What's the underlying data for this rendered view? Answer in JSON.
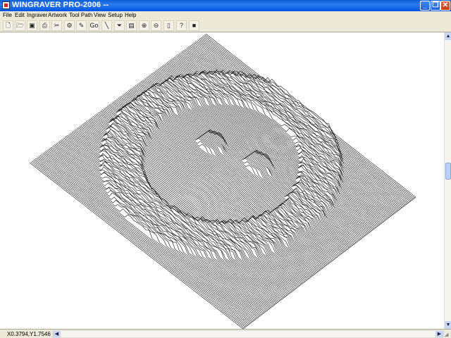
{
  "window": {
    "title": "WINGRAVER PRO-2006 --",
    "minimize_glyph": "_",
    "maximize_glyph": "❐",
    "close_glyph": "✕"
  },
  "menu": [
    {
      "label": "File"
    },
    {
      "label": "Edit"
    },
    {
      "label": "Ingraver"
    },
    {
      "label": "Artwork"
    },
    {
      "label": "Tool Path"
    },
    {
      "label": "View"
    },
    {
      "label": "Setup"
    },
    {
      "label": "Help"
    }
  ],
  "toolbar": [
    {
      "icon": "new-file-icon",
      "glyph": "🗋"
    },
    {
      "icon": "open-file-icon",
      "glyph": "🗁"
    },
    {
      "icon": "save-icon",
      "glyph": "▣"
    },
    {
      "icon": "print-icon",
      "glyph": "⎙"
    },
    {
      "icon": "cut-icon",
      "glyph": "✂"
    },
    {
      "icon": "tool-settings-icon",
      "glyph": "⚙"
    },
    {
      "icon": "engrave-icon",
      "glyph": "✎"
    },
    {
      "icon": "go-icon",
      "glyph": "Go"
    },
    {
      "icon": "line-tool-icon",
      "glyph": "╲"
    },
    {
      "icon": "flip-icon",
      "glyph": "⏷"
    },
    {
      "icon": "machine-icon",
      "glyph": "▤"
    },
    {
      "icon": "zoom-in-icon",
      "glyph": "⊕"
    },
    {
      "icon": "zoom-out-icon",
      "glyph": "⊖"
    },
    {
      "icon": "page-icon",
      "glyph": "▯"
    },
    {
      "icon": "help-icon",
      "glyph": "?"
    },
    {
      "icon": "stop-icon",
      "glyph": "■"
    }
  ],
  "status": {
    "coordinates": "X0.3794,Y1.7546"
  },
  "scroll": {
    "up": "▲",
    "down": "▼",
    "left": "◀",
    "right": "▶"
  },
  "colors": {
    "titlebar": "#0054e3",
    "canvas": "#ffffff",
    "stroke": "#111111"
  }
}
